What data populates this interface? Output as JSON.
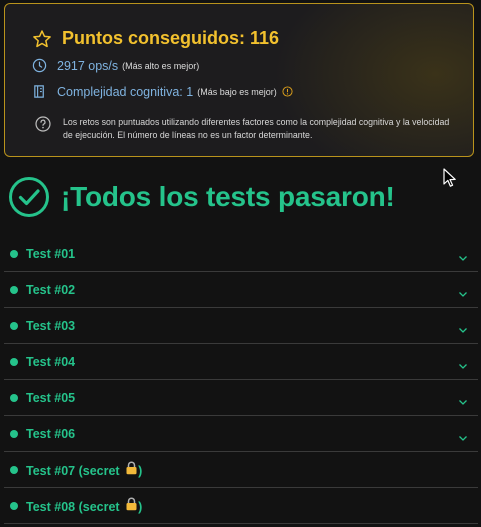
{
  "score": {
    "title": "Puntos conseguidos: 116",
    "ops_value": "2917 ops/s",
    "ops_note": "(Más alto es mejor)",
    "complexity_value": "Complejidad cognitiva: 1",
    "complexity_note": "(Más bajo es mejor)",
    "info_text": "Los retos son puntuados utilizando diferentes factores como la complejidad cognitiva y la velocidad de ejecución. El número de líneas no es un factor determinante."
  },
  "result": {
    "title": "¡Todos los tests pasaron!"
  },
  "tests": [
    {
      "label": "Test #01",
      "secret": false
    },
    {
      "label": "Test #02",
      "secret": false
    },
    {
      "label": "Test #03",
      "secret": false
    },
    {
      "label": "Test #04",
      "secret": false
    },
    {
      "label": "Test #05",
      "secret": false
    },
    {
      "label": "Test #06",
      "secret": false
    },
    {
      "label": "Test #07 (secret",
      "secret": true
    },
    {
      "label": "Test #08 (secret",
      "secret": true
    }
  ],
  "secret_suffix": ")",
  "colors": {
    "accent_gold": "#f2c12e",
    "success_green": "#25c38b",
    "stat_blue": "#7fb3e0"
  }
}
